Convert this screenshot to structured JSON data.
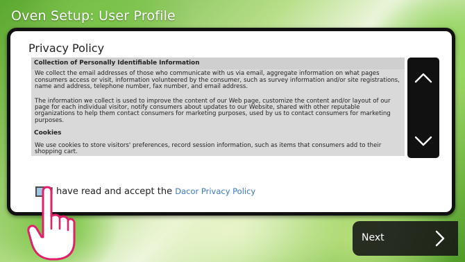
{
  "header": {
    "title": "Oven Setup: User Profile"
  },
  "dialog": {
    "title": "Privacy Policy",
    "policy": {
      "heading1": "Collection of Personally Identifiable Information",
      "paragraph1": "We collect the email addresses of those who communicate with us via email, aggregate information on what pages consumers access or visit, information volunteered by the consumer, such as survey information and/or site registrations, name and address, telephone number, fax number, and email address.",
      "paragraph2": "The information we collect is used to improve the content of our Web page, customize the content and/or layout of our page for each individual visitor, notify consumers about updates to our Website, shared with other reputable organizations to help them contact consumers for marketing purposes, used by us to contact consumers for marketing purposes.",
      "heading2": "Cookies",
      "paragraph3": "We use cookies to store visitors' preferences, record session information, such as items that consumers add to their shopping cart."
    },
    "scroll": {
      "up_icon": "chevron-up-icon",
      "down_icon": "chevron-down-icon"
    },
    "accept": {
      "checked": true,
      "label": "I have read and accept the",
      "link": "Dacor Privacy Policy"
    }
  },
  "next_button": {
    "label": "Next",
    "icon": "chevron-right-icon"
  },
  "colors": {
    "dialog_border": "#111111",
    "policy_bg": "#d9d9d9",
    "link": "#3b79c6",
    "hand_outline": "#e0206a",
    "checkbox_fill": "#9ec6e4"
  }
}
